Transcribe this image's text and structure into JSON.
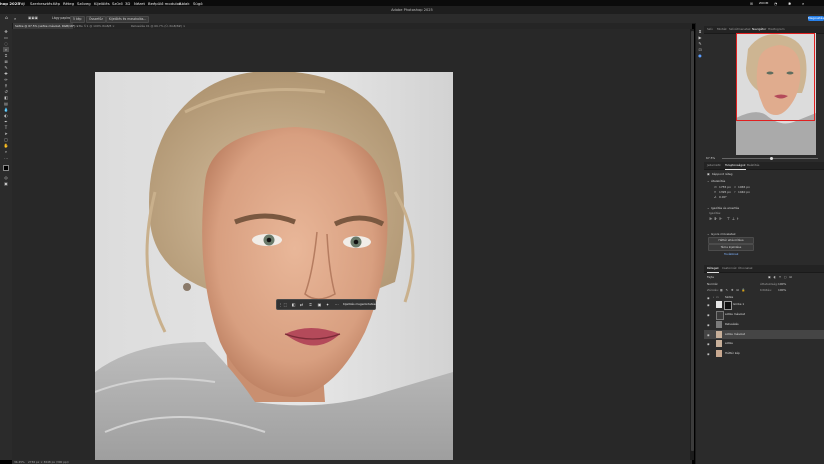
{
  "menubar": {
    "items": [
      "hop 2025",
      "Fájl",
      "Szerkesztés",
      "Kép",
      "Réteg",
      "Szöveg",
      "Kijelölés",
      "Szűrő",
      "3D",
      "Nézet",
      "Beépülő modulok",
      "Ablak",
      "Súgó"
    ],
    "right_items": [
      "⊞",
      "ZOOM",
      "◔",
      "✱",
      "⌕"
    ]
  },
  "app": {
    "title": "Adobe Photoshop 2025",
    "share_label": "Megosztás"
  },
  "options": {
    "home_icon": "home-icon",
    "size_label": "Lágy papírok:",
    "size_value": "5 kép",
    "btn1": "Összefűz",
    "btn2": "Kijelölés és maszkolás..."
  },
  "tabs": [
    {
      "label": "Szőke @ 67.5% (szőke másolat, RGB/16*) ×",
      "active": true
    },
    {
      "label": "Be ©1 @ 100% RGB/8 ×",
      "active": false
    },
    {
      "label": "Retusálás 01 @ 66.7% (Ü, RGB/8#) ×",
      "active": false
    }
  ],
  "status": {
    "zoom": "34.45%",
    "doc": "2736 px × 3648 px (300 ppi)"
  },
  "context_bar": {
    "label": "Kijelölés megszüntetése"
  },
  "panels": {
    "top_tabs": [
      "Szín",
      "Minták",
      "Színátmenetek",
      "Navigátor",
      "Hisztogram"
    ],
    "top_active": 3,
    "zoom_value": "67.5%",
    "mid_tabs": [
      "Jellemzők",
      "Tulajdonságok",
      "Beállítás"
    ],
    "mid_active": 1,
    "pixel_layer": "Képpont réteg",
    "transform": "Átalakítás",
    "w_label": "W",
    "w_value": "1755 px",
    "x_label": "X",
    "x_value": "1065 px",
    "h_label": "H",
    "h_value": "1395 px",
    "y_label": "Y",
    "y_value": "1040 px",
    "angle_value": "0.00°",
    "align_section": "Igazítás és elosztás",
    "align_sub": "Igazítás:",
    "quick_section": "Gyors műveletek",
    "btn_remove_bg": "Háttér eltávolítása",
    "btn_select_subject": "Téma kijelölése",
    "more": "Továbbiak"
  },
  "layers_panel": {
    "tabs": [
      "Rétegek",
      "Csatornák",
      "Útvonalak"
    ],
    "active": 0,
    "kind_label": "Fajta",
    "blend": "Normál",
    "opacity_label": "Áttetszőség:",
    "opacity": "100%",
    "lock_label": "Zárolás:",
    "fill_label": "Kitöltés:",
    "fill": "100%",
    "layers": [
      {
        "name": "Szőke",
        "selected": false,
        "thumb": "#b8a890"
      },
      {
        "name": "Görbe 1",
        "selected": false,
        "thumb": "#222222"
      },
      {
        "name": "szőke másolat",
        "selected": false,
        "thumb": "#a09080"
      },
      {
        "name": "Retusálás",
        "selected": false,
        "thumb": "#7a7a7a"
      },
      {
        "name": "szőke másolat",
        "selected": true,
        "thumb": "#c8b09a"
      },
      {
        "name": "szőke",
        "selected": false,
        "thumb": "#c8b09a"
      },
      {
        "name": "Háttér kép",
        "selected": false,
        "thumb": "#c8a890"
      }
    ]
  }
}
